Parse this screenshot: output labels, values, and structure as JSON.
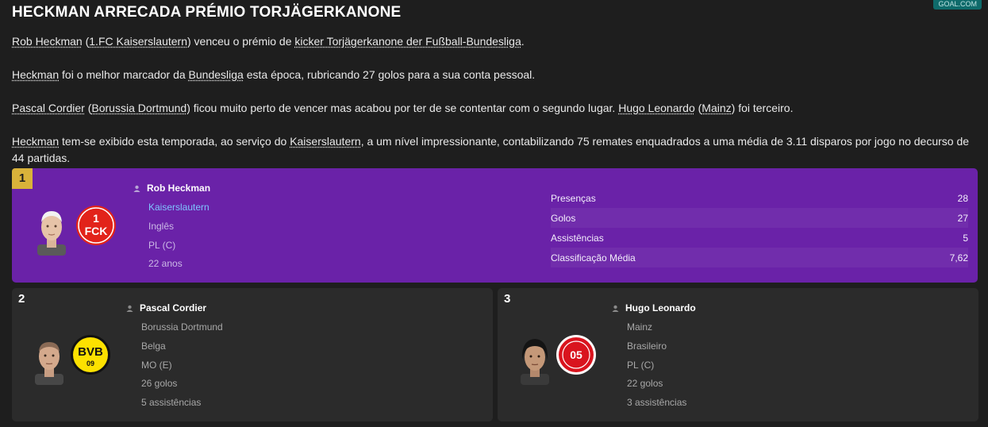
{
  "article": {
    "title": "HECKMAN ARRECADA PRÉMIO TORJÄGERKANONE",
    "source": "GOAL.COM",
    "p1": {
      "a": "Rob Heckman",
      "b": " (",
      "c": "1.FC Kaiserslautern",
      "d": ") venceu o prémio de ",
      "e": "kicker Torjägerkanone der Fußball-Bundesliga",
      "f": "."
    },
    "p2": {
      "a": "Heckman",
      "b": " foi o melhor marcador da ",
      "c": "Bundesliga",
      "d": " esta época, rubricando 27 golos para a sua conta pessoal."
    },
    "p3": {
      "a": "Pascal Cordier",
      "b": " (",
      "c": "Borussia Dortmund",
      "d": ") ficou muito perto de vencer mas acabou por ter de se contentar com o segundo lugar. ",
      "e": "Hugo Leonardo",
      "f": " (",
      "g": "Mainz",
      "h": ") foi terceiro."
    },
    "p4": {
      "a": "Heckman",
      "b": " tem-se exibido esta temporada, ao serviço do ",
      "c": "Kaiserslautern",
      "d": ", a um nível impressionante, contabilizando 75 remates enquadrados a uma média de 3.11 disparos por jogo no decurso de 44 partidas."
    }
  },
  "winners": {
    "first": {
      "rank": "1",
      "name": "Rob Heckman",
      "club": "Kaiserslautern",
      "nationality": "Inglês",
      "position": "PL (C)",
      "age": "22 anos",
      "stats": [
        {
          "label": "Presenças",
          "value": "28"
        },
        {
          "label": "Golos",
          "value": "27"
        },
        {
          "label": "Assistências",
          "value": "5"
        },
        {
          "label": "Classificação Média",
          "value": "7,62"
        }
      ]
    },
    "second": {
      "rank": "2",
      "name": "Pascal Cordier",
      "club": "Borussia Dortmund",
      "nationality": "Belga",
      "position": "MO (E)",
      "goals": "26 golos",
      "assists": "5 assistências"
    },
    "third": {
      "rank": "3",
      "name": "Hugo Leonardo",
      "club": "Mainz",
      "nationality": "Brasileiro",
      "position": "PL (C)",
      "goals": "22 golos",
      "assists": "3 assistências"
    }
  },
  "colors": {
    "background": "#1e1e1e",
    "winner_card": "#6a22a8",
    "gold_badge": "#d9b23a",
    "link": "#7fc4ff"
  }
}
